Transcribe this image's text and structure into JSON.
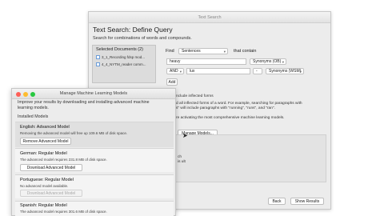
{
  "text_search": {
    "window_title": "Text Search",
    "heading": "Text Search: Define Query",
    "subtitle": "Search for combinations of words and compounds.",
    "selected_docs": {
      "title": "Selected Documents (2)",
      "items": [
        {
          "label": "3_1_Recording fdsp mod..."
        },
        {
          "label": "4_4_NYTM_reader comm..."
        }
      ]
    },
    "find_label": "Find",
    "find_scope": "Sentences",
    "that_contain": "that contain",
    "term1": "heavy",
    "synonyms1": "Synonyms (OB)",
    "and_label": "AND",
    "term2": "lux",
    "op2": "-",
    "synonyms2": "Synonyms (WSM)",
    "add_label": "Add",
    "info_line0": "nclude inflected forms",
    "info_line1": "d all inflected forms of a word. For example, searching for paragraphs with",
    "info_line2": "s\" will include paragraphs with \"running\", \"runs\", and \"ran\".",
    "info_line3": "re activating the most comprehensive machine learning models.",
    "manage_models_button": "Manage Models...",
    "lower_text1": "ch",
    "lower_text2": "is ult",
    "back_button": "Back",
    "show_results_button": "Show Results"
  },
  "manage_models": {
    "window_title": "Manage Machine Learning Models",
    "description": "Improve your results by downloading and installing advanced machine learning models.",
    "installed_label": "Installed Models",
    "models": [
      {
        "name": "English: Advanced Model",
        "desc": "Removing the advanced model will free up 109.6 MB of disk space.",
        "button": "Remove Advanced Model",
        "disabled": false
      },
      {
        "name": "German: Regular Model",
        "desc": "The advanced model requires 231.8 MB of disk space.",
        "button": "Download Advanced Model",
        "disabled": false
      },
      {
        "name": "Portuguese: Regular Model",
        "desc": "No advanced model available.",
        "button": "Download Advanced Model",
        "disabled": true
      },
      {
        "name": "Spanish: Regular Model",
        "desc": "The advanced model requires 301.6 MB of disk space.",
        "button": "",
        "disabled": false
      }
    ]
  },
  "colors": {
    "traffic_red": "#fe5f57",
    "traffic_yellow": "#febc2e",
    "traffic_green": "#28c840",
    "checkbox": "#6a9cd8"
  }
}
